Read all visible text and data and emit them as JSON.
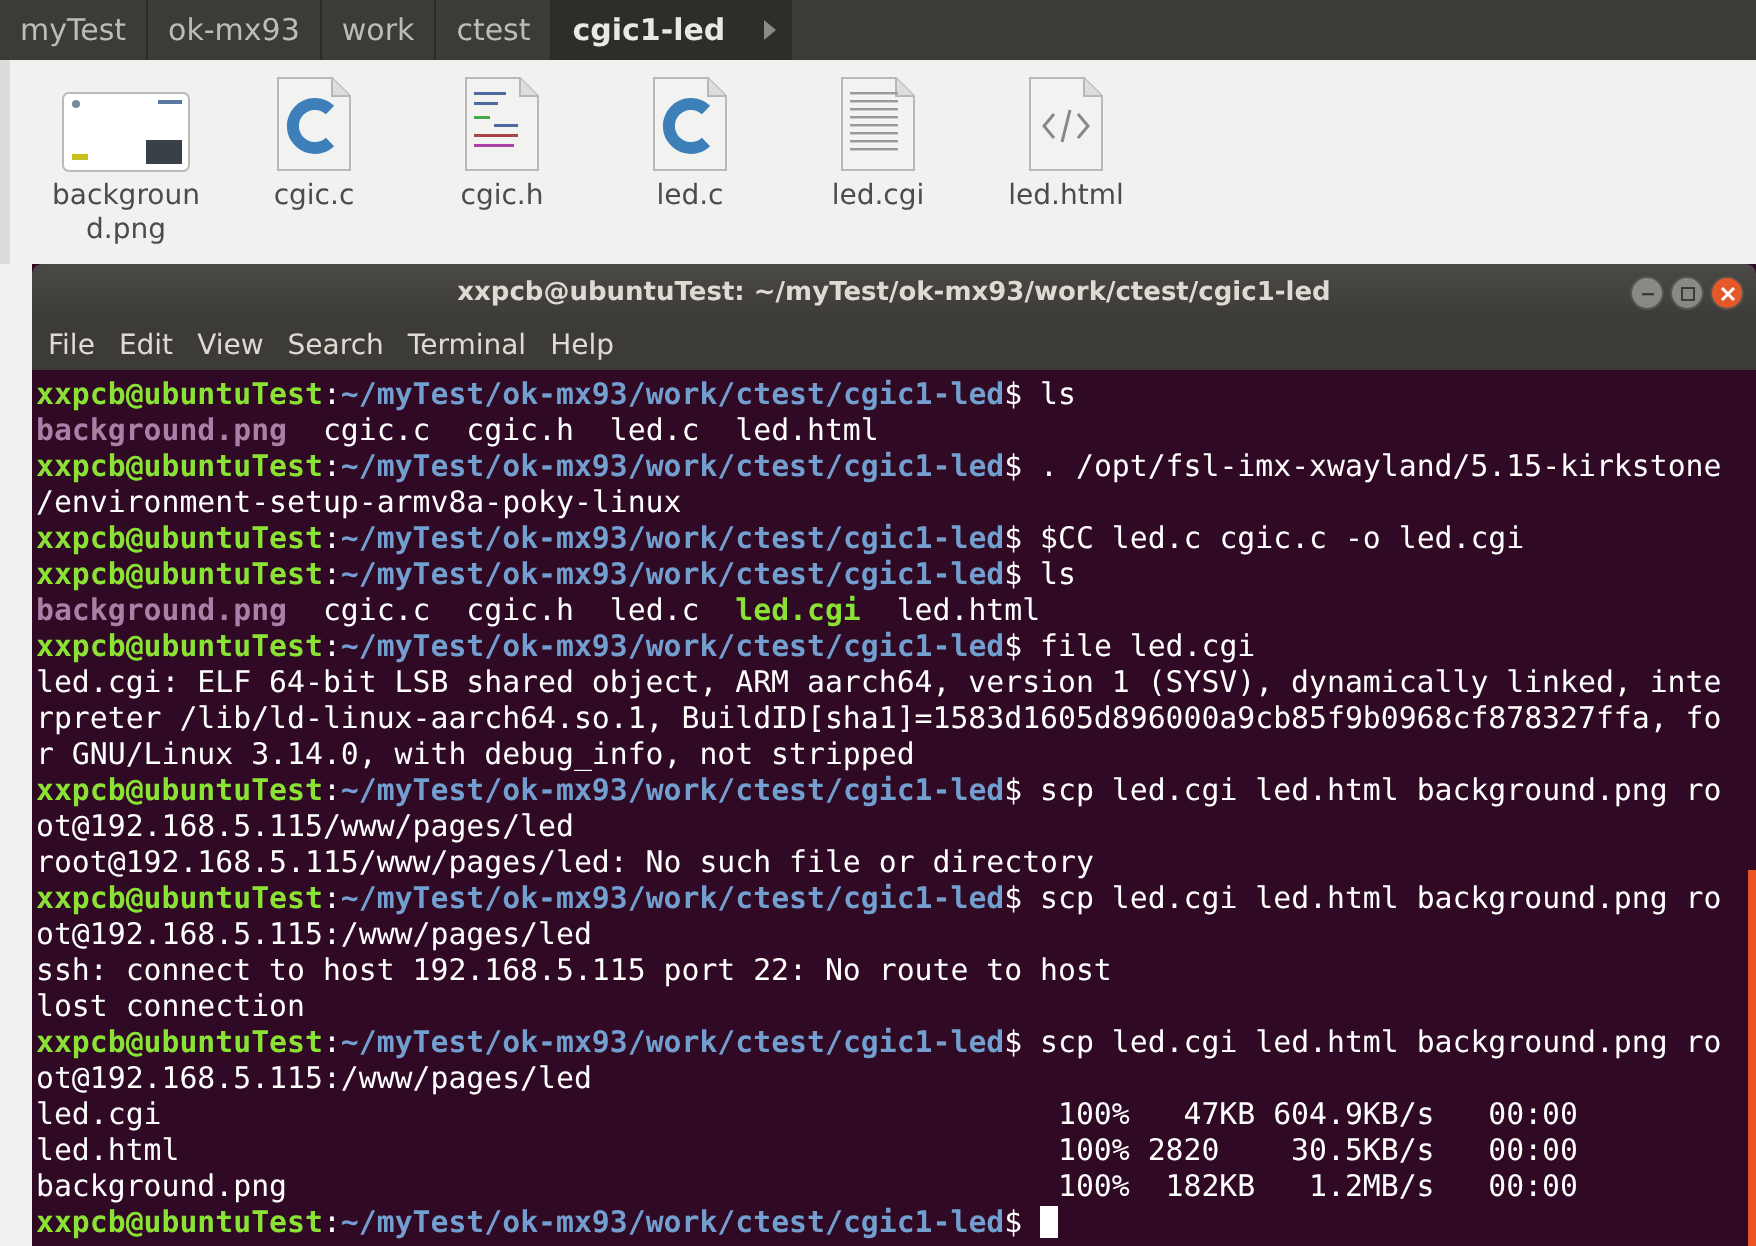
{
  "breadcrumbs": [
    {
      "label": "myTest",
      "selected": false
    },
    {
      "label": "ok-mx93",
      "selected": false
    },
    {
      "label": "work",
      "selected": false
    },
    {
      "label": "ctest",
      "selected": false
    },
    {
      "label": "cgic1-led",
      "selected": true
    }
  ],
  "files": [
    {
      "name": "backgroun d.png",
      "kind": "image"
    },
    {
      "name": "cgic.c",
      "kind": "c"
    },
    {
      "name": "cgic.h",
      "kind": "header"
    },
    {
      "name": "led.c",
      "kind": "c"
    },
    {
      "name": "led.cgi",
      "kind": "text"
    },
    {
      "name": "led.html",
      "kind": "html"
    }
  ],
  "terminal": {
    "title": "xxpcb@ubuntuTest: ~/myTest/ok-mx93/work/ctest/cgic1-led",
    "menu": [
      "File",
      "Edit",
      "View",
      "Search",
      "Terminal",
      "Help"
    ],
    "lines": [
      {
        "segments": [
          {
            "kind": "user",
            "text": "xxpcb@ubuntuTest"
          },
          {
            "kind": "plain",
            "text": ":"
          },
          {
            "kind": "path",
            "text": "~/myTest/ok-mx93/work/ctest/cgic1-led"
          },
          {
            "kind": "plain",
            "text": "$ ls"
          }
        ]
      },
      {
        "segments": [
          {
            "kind": "image",
            "text": "background.png"
          },
          {
            "kind": "plain",
            "text": "  cgic.c  cgic.h  led.c  led.html"
          }
        ]
      },
      {
        "segments": [
          {
            "kind": "user",
            "text": "xxpcb@ubuntuTest"
          },
          {
            "kind": "plain",
            "text": ":"
          },
          {
            "kind": "path",
            "text": "~/myTest/ok-mx93/work/ctest/cgic1-led"
          },
          {
            "kind": "plain",
            "text": "$ . /opt/fsl-imx-xwayland/5.15-kirkstone"
          }
        ]
      },
      {
        "segments": [
          {
            "kind": "plain",
            "text": "/environment-setup-armv8a-poky-linux"
          }
        ]
      },
      {
        "segments": [
          {
            "kind": "user",
            "text": "xxpcb@ubuntuTest"
          },
          {
            "kind": "plain",
            "text": ":"
          },
          {
            "kind": "path",
            "text": "~/myTest/ok-mx93/work/ctest/cgic1-led"
          },
          {
            "kind": "plain",
            "text": "$ $CC led.c cgic.c -o led.cgi"
          }
        ]
      },
      {
        "segments": [
          {
            "kind": "user",
            "text": "xxpcb@ubuntuTest"
          },
          {
            "kind": "plain",
            "text": ":"
          },
          {
            "kind": "path",
            "text": "~/myTest/ok-mx93/work/ctest/cgic1-led"
          },
          {
            "kind": "plain",
            "text": "$ ls"
          }
        ]
      },
      {
        "segments": [
          {
            "kind": "image",
            "text": "background.png"
          },
          {
            "kind": "plain",
            "text": "  cgic.c  cgic.h  led.c  "
          },
          {
            "kind": "executable",
            "text": "led.cgi"
          },
          {
            "kind": "plain",
            "text": "  led.html"
          }
        ]
      },
      {
        "segments": [
          {
            "kind": "user",
            "text": "xxpcb@ubuntuTest"
          },
          {
            "kind": "plain",
            "text": ":"
          },
          {
            "kind": "path",
            "text": "~/myTest/ok-mx93/work/ctest/cgic1-led"
          },
          {
            "kind": "plain",
            "text": "$ file led.cgi"
          }
        ]
      },
      {
        "segments": [
          {
            "kind": "plain",
            "text": "led.cgi: ELF 64-bit LSB shared object, ARM aarch64, version 1 (SYSV), dynamically linked, inte"
          }
        ]
      },
      {
        "segments": [
          {
            "kind": "plain",
            "text": "rpreter /lib/ld-linux-aarch64.so.1, BuildID[sha1]=1583d1605d896000a9cb85f9b0968cf878327ffa, fo"
          }
        ]
      },
      {
        "segments": [
          {
            "kind": "plain",
            "text": "r GNU/Linux 3.14.0, with debug_info, not stripped"
          }
        ]
      },
      {
        "segments": [
          {
            "kind": "user",
            "text": "xxpcb@ubuntuTest"
          },
          {
            "kind": "plain",
            "text": ":"
          },
          {
            "kind": "path",
            "text": "~/myTest/ok-mx93/work/ctest/cgic1-led"
          },
          {
            "kind": "plain",
            "text": "$ scp led.cgi led.html background.png ro"
          }
        ]
      },
      {
        "segments": [
          {
            "kind": "plain",
            "text": "ot@192.168.5.115/www/pages/led"
          }
        ]
      },
      {
        "segments": [
          {
            "kind": "plain",
            "text": "root@192.168.5.115/www/pages/led: No such file or directory"
          }
        ]
      },
      {
        "segments": [
          {
            "kind": "user",
            "text": "xxpcb@ubuntuTest"
          },
          {
            "kind": "plain",
            "text": ":"
          },
          {
            "kind": "path",
            "text": "~/myTest/ok-mx93/work/ctest/cgic1-led"
          },
          {
            "kind": "plain",
            "text": "$ scp led.cgi led.html background.png ro"
          }
        ]
      },
      {
        "segments": [
          {
            "kind": "plain",
            "text": "ot@192.168.5.115:/www/pages/led"
          }
        ]
      },
      {
        "segments": [
          {
            "kind": "plain",
            "text": "ssh: connect to host 192.168.5.115 port 22: No route to host"
          }
        ]
      },
      {
        "segments": [
          {
            "kind": "plain",
            "text": "lost connection"
          }
        ]
      },
      {
        "segments": [
          {
            "kind": "user",
            "text": "xxpcb@ubuntuTest"
          },
          {
            "kind": "plain",
            "text": ":"
          },
          {
            "kind": "path",
            "text": "~/myTest/ok-mx93/work/ctest/cgic1-led"
          },
          {
            "kind": "plain",
            "text": "$ scp led.cgi led.html background.png ro"
          }
        ]
      },
      {
        "segments": [
          {
            "kind": "plain",
            "text": "ot@192.168.5.115:/www/pages/led"
          }
        ]
      },
      {
        "segments": [
          {
            "kind": "plain",
            "text": "led.cgi                                                  100%   47KB 604.9KB/s   00:00"
          }
        ]
      },
      {
        "segments": [
          {
            "kind": "plain",
            "text": "led.html                                                 100% 2820    30.5KB/s   00:00"
          }
        ]
      },
      {
        "segments": [
          {
            "kind": "plain",
            "text": "background.png                                           100%  182KB   1.2MB/s   00:00"
          }
        ]
      },
      {
        "segments": [
          {
            "kind": "user",
            "text": "xxpcb@ubuntuTest"
          },
          {
            "kind": "plain",
            "text": ":"
          },
          {
            "kind": "path",
            "text": "~/myTest/ok-mx93/work/ctest/cgic1-led"
          },
          {
            "kind": "plain",
            "text": "$"
          }
        ],
        "cursor": true
      }
    ]
  }
}
